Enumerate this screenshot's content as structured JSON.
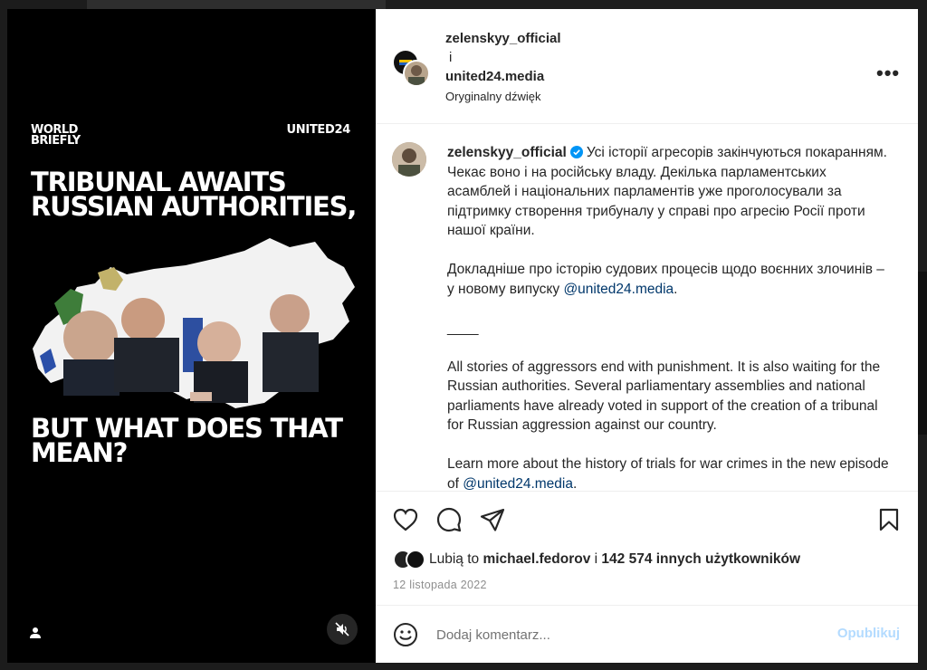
{
  "post": {
    "media": {
      "brand_left_line1": "WORLD",
      "brand_left_line2": "BRIEFLY",
      "brand_right": "UNITED24",
      "headline_top": "TRIBUNAL AWAITS RUSSIAN AUTHORITIES,",
      "headline_bottom": "BUT WHAT DOES THAT MEAN?"
    },
    "header": {
      "author": "zelenskyy_official",
      "conjunction": "i",
      "collaborator": "united24.media",
      "audio": "Oryginalny dźwięk",
      "more": "•••"
    },
    "caption": {
      "author": "zelenskyy_official",
      "uk_para1": "Усі історії агресорів закінчуються покаранням. Чекає воно і на російську владу. Декілька парламентських асамблей і національних парламентів уже проголосували за підтримку створення трибуналу у справі про агресію Росії проти нашої країни.",
      "uk_para2_text": "Докладніше про історію судових процесів щодо воєнних злочинів – у новому випуску ",
      "uk_para2_mention": "@united24.media",
      "uk_para2_end": ".",
      "separator": "____",
      "en_para1": "All stories of aggressors end with punishment. It is also waiting for the Russian authorities. Several parliamentary assemblies and national parliaments have already voted in support of the creation of a tribunal for Russian aggression against our country.",
      "en_para2_text": "Learn more about the history of trials for war crimes in the new episode of ",
      "en_para2_mention": "@united24.media",
      "en_para2_end": "."
    },
    "likes": {
      "prefix": "Lubią to ",
      "user": "michael.fedorov",
      "middle": " i ",
      "count": "142 574 innych użytkowników"
    },
    "date": "12 listopada 2022",
    "comment": {
      "placeholder": "Dodaj komentarz...",
      "publish": "Opublikuj"
    }
  },
  "icons": [
    "heart-icon",
    "comment-icon",
    "share-icon",
    "bookmark-icon",
    "emoji-icon",
    "mute-icon",
    "user-tag-icon",
    "verified-icon",
    "more-icon"
  ],
  "colors": {
    "mention": "#00376b",
    "verified": "#0095f6",
    "publish_disabled": "#b3dbff",
    "date": "#8e8e8e"
  }
}
